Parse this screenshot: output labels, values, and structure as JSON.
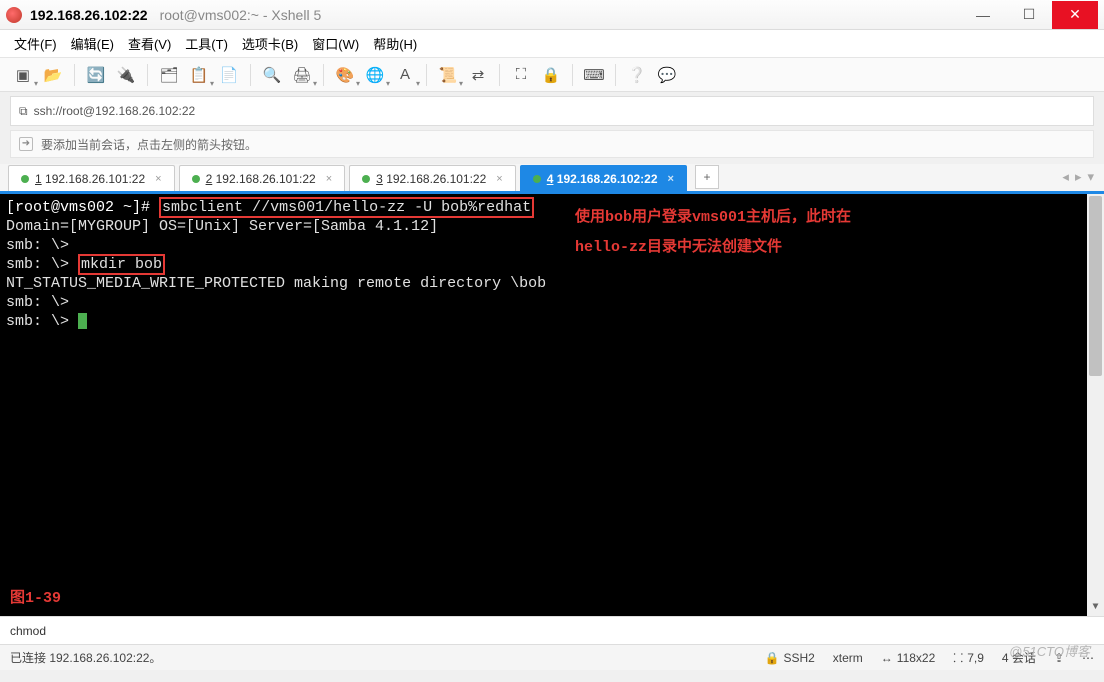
{
  "window": {
    "title_main": "192.168.26.102:22",
    "title_sub": "root@vms002:~ - Xshell 5"
  },
  "menu": {
    "file": "文件(F)",
    "edit": "编辑(E)",
    "view": "查看(V)",
    "tools": "工具(T)",
    "tab": "选项卡(B)",
    "window": "窗口(W)",
    "help": "帮助(H)"
  },
  "address": {
    "scheme_icon": "⧉",
    "url": "ssh://root@192.168.26.102:22"
  },
  "info": {
    "hint": "要添加当前会话，点击左侧的箭头按钮。"
  },
  "tabs": [
    {
      "num": "1",
      "label": "192.168.26.101:22"
    },
    {
      "num": "2",
      "label": "192.168.26.101:22"
    },
    {
      "num": "3",
      "label": "192.168.26.101:22"
    },
    {
      "num": "4",
      "label": "192.168.26.102:22"
    }
  ],
  "addtab": "+",
  "terminal": {
    "prompt": "[root@vms002 ~]#",
    "cmd1": "smbclient //vms001/hello-zz -U bob%redhat",
    "line2": "Domain=[MYGROUP] OS=[Unix] Server=[Samba 4.1.12]",
    "smb_prompt": "smb: \\>",
    "cmd2": "mkdir bob ",
    "err": "NT_STATUS_MEDIA_WRITE_PROTECTED making remote directory \\bob",
    "ann1": "使用bob用户登录vms001主机后，此时在",
    "ann2": "hello-zz目录中无法创建文件",
    "fig": "图1-39"
  },
  "input": {
    "value": "chmod"
  },
  "status": {
    "conn": "已连接 192.168.26.102:22。",
    "proto_icon": "🔒",
    "proto": "SSH2",
    "term": "xterm",
    "size_icon": "↔",
    "size": "118x22",
    "pos_icon": "⸬",
    "pos": "7,9",
    "sessions": "4 会话",
    "caps_icon": "⇪",
    "more_icon": "⋯"
  },
  "watermark": "@51CTO博客"
}
